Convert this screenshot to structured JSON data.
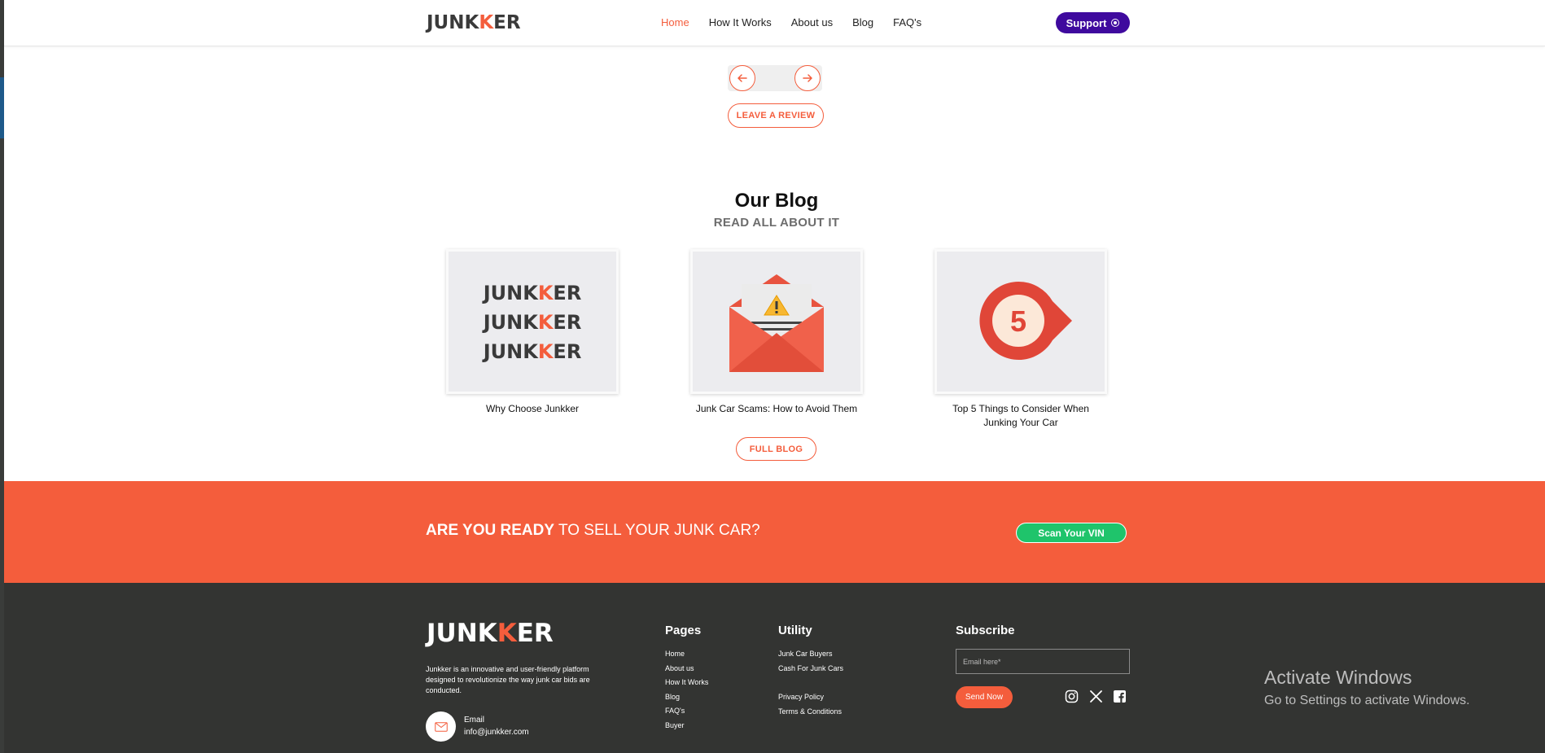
{
  "header": {
    "logo": {
      "pre": "JU",
      "n": "N",
      "k1": "K",
      "k2": "K",
      "post": "ER"
    },
    "nav": [
      "Home",
      "How It Works",
      "About us",
      "Blog",
      "FAQ's"
    ],
    "active_nav": "Home",
    "support_label": "Support"
  },
  "reviews": {
    "prev_icon": "arrow-left-icon",
    "next_icon": "arrow-right-icon",
    "leave_review_label": "LEAVE A REVIEW"
  },
  "blog": {
    "title": "Our Blog",
    "subtitle": "READ ALL ABOUT IT",
    "posts": [
      {
        "title": "Why Choose Junkker",
        "image": "junkker-logo-stack"
      },
      {
        "title": "Junk Car Scams: How to Avoid Them",
        "image": "warning-envelope"
      },
      {
        "title": "Top 5 Things to Consider When Junking Your Car",
        "image": "number-5-badge",
        "badge_number": "5"
      }
    ],
    "full_blog_label": "FULL BLOG"
  },
  "cta": {
    "bold": "ARE YOU READY",
    "rest": " TO SELL YOUR JUNK CAR?",
    "button_label": "Scan Your VIN"
  },
  "footer": {
    "about": "Junkker is an innovative and user-friendly platform designed to revolutionize the way junk car bids are conducted.",
    "email_label": "Email",
    "email_value": "info@junkker.com",
    "pages_title": "Pages",
    "pages": [
      "Home",
      "About us",
      "How It Works",
      "Blog",
      "FAQ's",
      "Buyer"
    ],
    "utility_title": "Utility",
    "utility_a": [
      "Junk Car Buyers",
      "Cash For Junk Cars"
    ],
    "utility_b": [
      "Privacy Policy",
      "Terms & Conditions"
    ],
    "subscribe_title": "Subscribe",
    "email_placeholder": "Email here*",
    "send_label": "Send Now",
    "socials": [
      "instagram-icon",
      "x-icon",
      "facebook-icon"
    ]
  },
  "watermark": {
    "line1": "Activate Windows",
    "line2": "Go to Settings to activate Windows."
  },
  "colors": {
    "accent": "#f45d3c",
    "support": "#3f0a9e",
    "vin_button": "#1fc46b",
    "footer_bg": "#333432"
  }
}
